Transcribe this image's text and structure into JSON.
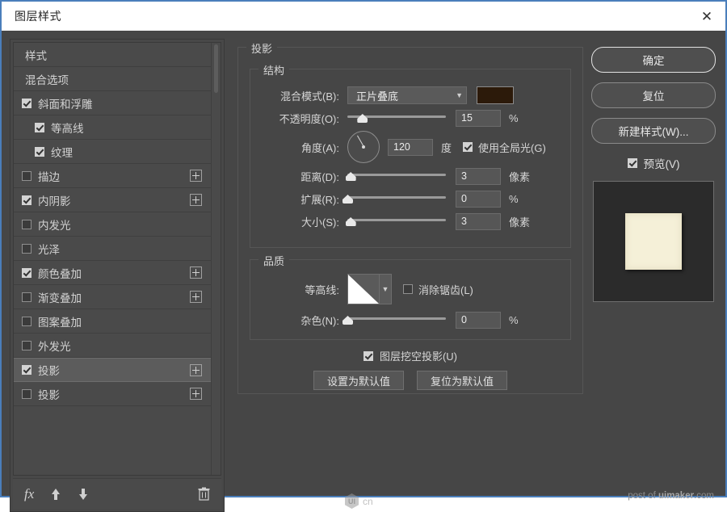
{
  "window": {
    "title": "图层样式",
    "close_icon": "close-icon"
  },
  "sidebar": {
    "items": [
      {
        "label": "样式",
        "type": "plain",
        "checked": null,
        "plus": false
      },
      {
        "label": "混合选项",
        "type": "plain",
        "checked": null,
        "plus": false
      },
      {
        "label": "斜面和浮雕",
        "type": "check",
        "checked": true,
        "plus": false
      },
      {
        "label": "等高线",
        "type": "sub",
        "checked": true,
        "plus": false
      },
      {
        "label": "纹理",
        "type": "sub",
        "checked": true,
        "plus": false
      },
      {
        "label": "描边",
        "type": "check",
        "checked": false,
        "plus": true
      },
      {
        "label": "内阴影",
        "type": "check",
        "checked": true,
        "plus": true
      },
      {
        "label": "内发光",
        "type": "check",
        "checked": false,
        "plus": false
      },
      {
        "label": "光泽",
        "type": "check",
        "checked": false,
        "plus": false
      },
      {
        "label": "颜色叠加",
        "type": "check",
        "checked": true,
        "plus": true
      },
      {
        "label": "渐变叠加",
        "type": "check",
        "checked": false,
        "plus": true
      },
      {
        "label": "图案叠加",
        "type": "check",
        "checked": false,
        "plus": false
      },
      {
        "label": "外发光",
        "type": "check",
        "checked": false,
        "plus": false
      },
      {
        "label": "投影",
        "type": "check",
        "checked": true,
        "plus": true,
        "selected": true
      },
      {
        "label": "投影",
        "type": "check",
        "checked": false,
        "plus": true
      }
    ],
    "toolbar": {
      "fx_icon": "fx-icon",
      "fx_label": "fx",
      "move_up_icon": "arrow-up-icon",
      "move_down_icon": "arrow-down-icon",
      "delete_icon": "trash-icon"
    }
  },
  "main": {
    "section_title": "投影",
    "structure": {
      "title": "结构",
      "blend_mode": {
        "label": "混合模式(B):",
        "value": "正片叠底",
        "caret_icon": "chevron-down-icon",
        "color": "#2c1a0a"
      },
      "opacity": {
        "label": "不透明度(O):",
        "value": "15",
        "unit": "%",
        "percent": 15
      },
      "angle": {
        "label": "角度(A):",
        "value": "120",
        "unit": "度",
        "use_global_light_label": "使用全局光(G)",
        "use_global_light_checked": true
      },
      "distance": {
        "label": "距离(D):",
        "value": "3",
        "unit": "像素",
        "percent": 3
      },
      "spread": {
        "label": "扩展(R):",
        "value": "0",
        "unit": "%",
        "percent": 0
      },
      "size": {
        "label": "大小(S):",
        "value": "3",
        "unit": "像素",
        "percent": 3
      }
    },
    "quality": {
      "title": "品质",
      "contour": {
        "label": "等高线:",
        "caret_icon": "chevron-down-icon",
        "antialias_label": "消除锯齿(L)",
        "antialias_checked": false
      },
      "noise": {
        "label": "杂色(N):",
        "value": "0",
        "unit": "%",
        "percent": 0
      }
    },
    "knockout": {
      "label": "图层挖空投影(U)",
      "checked": true
    },
    "buttons": {
      "set_default": "设置为默认值",
      "reset_default": "复位为默认值"
    }
  },
  "right": {
    "ok": "确定",
    "reset": "复位",
    "new_style": "新建样式(W)...",
    "preview_label": "预览(V)",
    "preview_checked": true
  },
  "watermarks": {
    "uicn_logo": "UI",
    "uicn_text": "cn",
    "uimaker_prefix": "post of ",
    "uimaker_name": "uimaker",
    "uimaker_tld": ".com"
  }
}
